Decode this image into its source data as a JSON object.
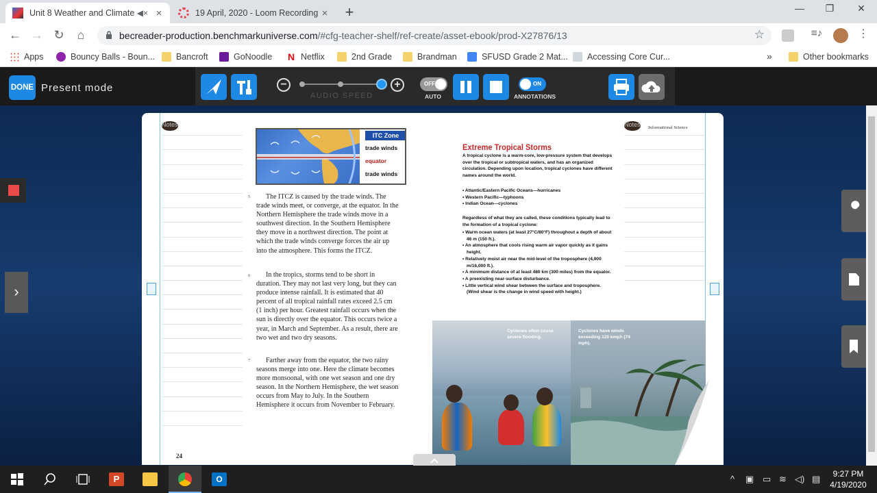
{
  "browser": {
    "tabs": [
      {
        "title": "Unit 8 Weather and Climate",
        "audio_icon": "speaker-muted-icon",
        "close": "×"
      },
      {
        "title": "19 April, 2020 - Loom Recording",
        "close": "×"
      }
    ],
    "new_tab": "+",
    "window_controls": {
      "minimize": "—",
      "maximize": "❐",
      "close": "✕"
    },
    "url_main": "becreader-production.benchmarkuniverse.com",
    "url_rest": "/#cfg-teacher-shelf/ref-create/asset-ebook/prod-X27876/13",
    "bookmarks": [
      {
        "label": "Apps"
      },
      {
        "label": "Bouncy Balls - Boun..."
      },
      {
        "label": "Bancroft"
      },
      {
        "label": "GoNoodle"
      },
      {
        "label": "Netflix"
      },
      {
        "label": "2nd Grade"
      },
      {
        "label": "Brandman"
      },
      {
        "label": "SFUSD Grade 2 Mat..."
      },
      {
        "label": "Accessing Core Cur..."
      }
    ],
    "bookmarks_overflow": "»",
    "other_bookmarks": "Other bookmarks"
  },
  "app": {
    "done_label": "DONE",
    "mode_label": "Present mode",
    "audio_speed_label": "AUDIO SPEED",
    "auto_toggle": "OFF",
    "auto_label": "AUTO",
    "annotations_toggle": "ON",
    "annotations_label": "ANNOTATIONS",
    "audio_speed_level": 1.0
  },
  "book": {
    "notes_label": "Notes",
    "page_left": "24",
    "header_right": "Informational Science",
    "itcz": {
      "title": "ITC Zone",
      "labels": [
        "trade winds",
        "equator",
        "trade winds"
      ]
    },
    "paragraphs": [
      {
        "num": "5",
        "text": "The ITCZ is caused by the trade winds. The trade winds meet, or converge, at the equator. In the Northern Hemisphere the trade winds move in a southwest direction. In the Southern Hemisphere they move in a northwest direction. The point at which the trade winds converge forces the air up into the atmosphere. This forms the ITCZ."
      },
      {
        "num": "6",
        "text": "In the tropics, storms tend to be short in duration. They may not last very long, but they can produce intense rainfall. It is estimated that 40 percent of all tropical rainfall rates exceed 2.5 cm (1 inch) per hour. Greatest rainfall occurs when the sun is directly over the equator. This occurs twice a year, in March and September. As a result, there are two wet and two dry seasons."
      },
      {
        "num": "7",
        "text": "Farther away from the equator, the two rainy seasons merge into one. Here the climate becomes more monsoonal, with one wet season and one dry season. In the Northern Hemisphere, the wet season occurs from May to July. In the Southern Hemisphere it occurs from November to February."
      }
    ],
    "sidebar": {
      "title": "Extreme Tropical Storms",
      "intro": "A tropical cyclone is a warm-core, low-pressure system that develops over the tropical or subtropical waters, and has an organized circulation. Depending upon location, tropical cyclones have different names around the world.",
      "names": [
        "• Atlantic/Eastern Pacific Oceans—hurricanes",
        "• Western Pacific—typhoons",
        "• Indian Ocean—cyclones"
      ],
      "conditions_intro": "Regardless of what they are called, these conditions typically lead to the formation of a tropical cyclone:",
      "conditions": [
        "• Warm ocean waters (at least 27°C/80°F) throughout a depth of about 46 m (150 ft.).",
        "• An atmosphere that cools rising warm air vapor quickly as it gains height.",
        "• Relatively moist air near the mid-level of the troposphere (4,900 m/16,000 ft.).",
        "• A minimum distance of at least 480 km (300 miles) from the equator.",
        "• A preexisting near-surface disturbance.",
        "• Little vertical wind shear between the surface and troposphere. (Wind shear is the change in wind speed with height.)"
      ],
      "caption1": "Cyclones often cause severe flooding.",
      "caption2": "Cyclones have winds exceeding 120 kmph (74 mph)."
    }
  },
  "taskbar": {
    "time": "9:27 PM",
    "date": "4/19/2020"
  }
}
